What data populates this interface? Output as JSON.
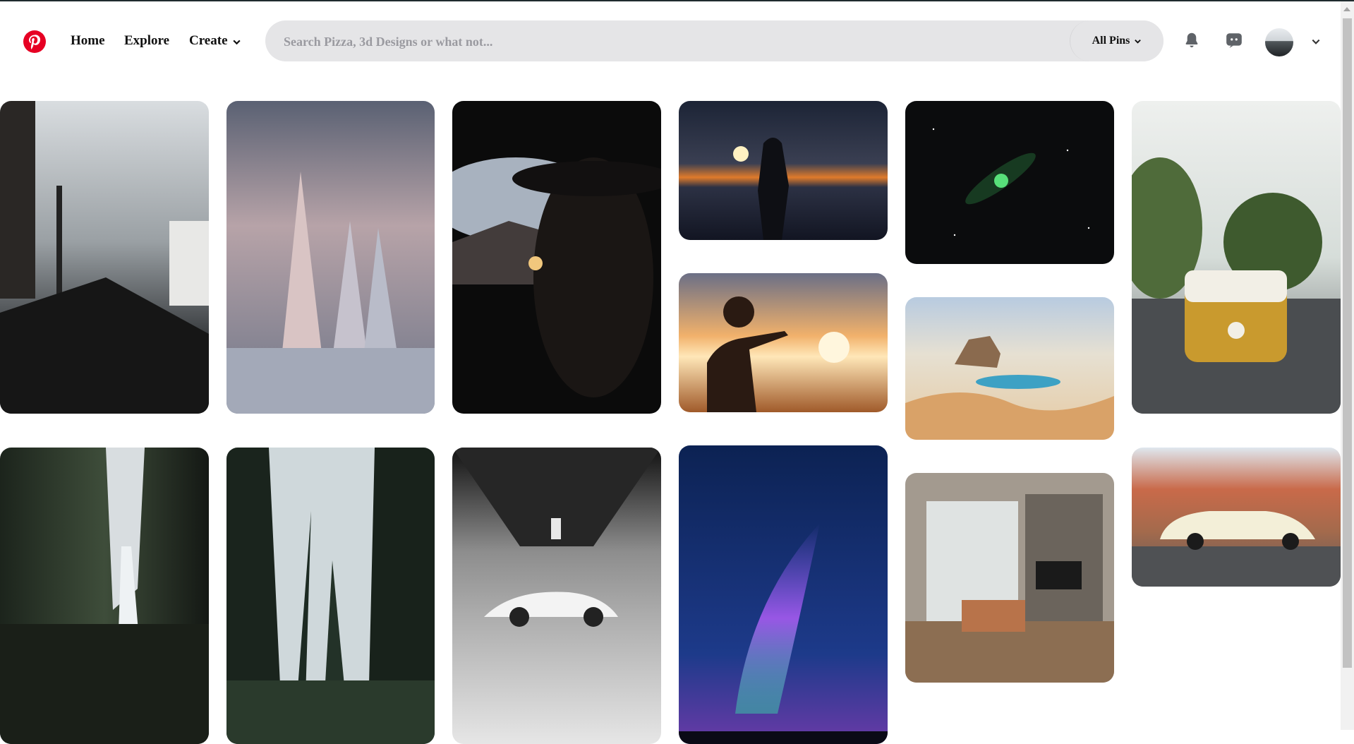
{
  "nav": {
    "home": "Home",
    "explore": "Explore",
    "create": "Create"
  },
  "search": {
    "placeholder": "Search Pizza, 3d Designs or what not...",
    "filter_label": "All Pins"
  },
  "icons": {
    "logo": "pinterest-logo-icon",
    "bell": "bell-icon",
    "chat": "chat-icon",
    "chevron": "chevron-down-icon"
  },
  "colors": {
    "brand": "#e60023",
    "search_bg": "#e5e5e7"
  },
  "pins": [
    {
      "name": "pin-city-street-tram"
    },
    {
      "name": "pin-snowy-pine-trees"
    },
    {
      "name": "pin-silhouette-man-hat"
    },
    {
      "name": "pin-lantern-by-sea"
    },
    {
      "name": "pin-green-comet-night-sky"
    },
    {
      "name": "pin-yellow-vw-van"
    },
    {
      "name": "pin-boy-pointing-sunset"
    },
    {
      "name": "pin-geyser-painting"
    },
    {
      "name": "pin-waterfall-canyon"
    },
    {
      "name": "pin-forest-mountain"
    },
    {
      "name": "pin-white-porsche-garage"
    },
    {
      "name": "pin-aurora-night-sky"
    },
    {
      "name": "pin-modern-living-room"
    },
    {
      "name": "pin-classic-car-desert"
    }
  ]
}
